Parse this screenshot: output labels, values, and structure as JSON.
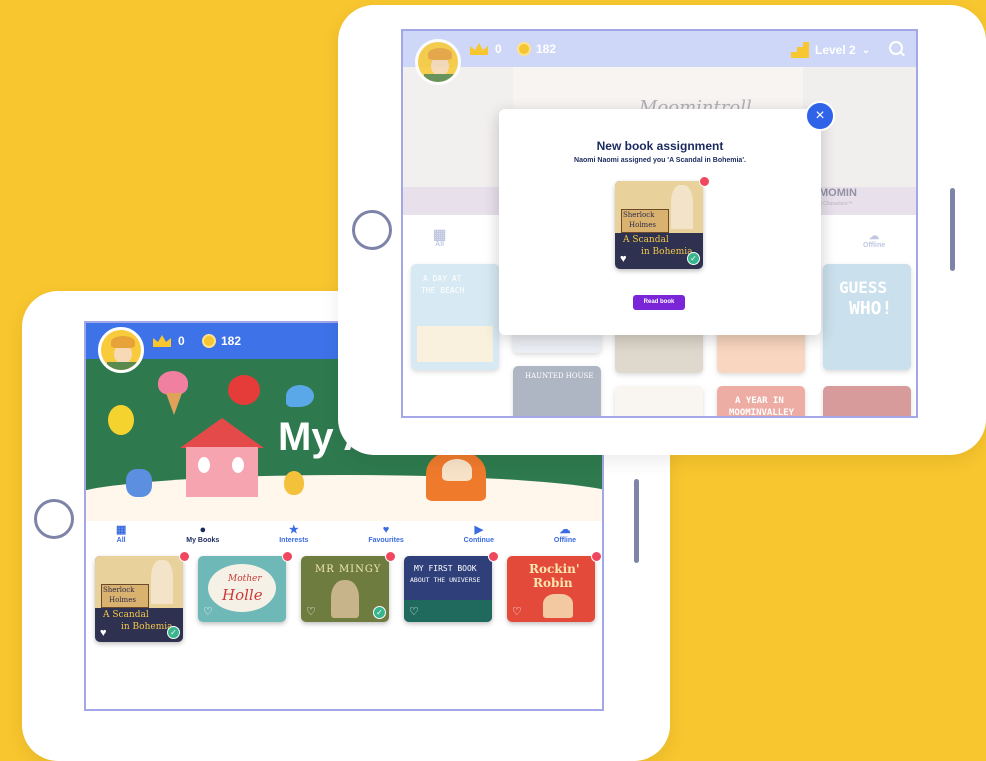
{
  "app": {
    "crowns": "0",
    "coins": "182",
    "level": "Level 2"
  },
  "front": {
    "banner_title": "My A",
    "tabs": [
      {
        "label": "All",
        "icon": "grid-icon"
      },
      {
        "label": "My Books",
        "icon": "person-icon"
      },
      {
        "label": "Interests",
        "icon": "star-icon"
      },
      {
        "label": "Favourites",
        "icon": "heart-icon"
      },
      {
        "label": "Continue",
        "icon": "play-icon"
      },
      {
        "label": "Offline",
        "icon": "cloud-download-icon"
      }
    ],
    "books": [
      {
        "line1": "Sherlock",
        "line2": "Holmes",
        "line3": "A Scandal",
        "line4": "in Bohemia"
      },
      {
        "line1": "Mother",
        "line2": "Holle"
      },
      {
        "line1": "MR MINGY"
      },
      {
        "line1": "MY FIRST BOOK",
        "line2": "ABOUT THE UNIVERSE"
      },
      {
        "line1": "Rockin'",
        "line2": "Robin"
      }
    ]
  },
  "back": {
    "banner_title": "Moomintroll",
    "banner_right": "MOMIN",
    "banner_right_sub": "n Characters™",
    "tab_all": "All",
    "tab_offline": "Offline",
    "books": [
      {
        "line1": "A DAY AT",
        "line2": "THE BEACH"
      },
      {
        "line1": "HAUNTED HOUSE"
      },
      {
        "line1": "A YEAR IN",
        "line2": "MOOMINVALLEY"
      },
      {
        "line1": "GUESS",
        "line2": "WHO!"
      }
    ],
    "modal": {
      "title": "New book assignment",
      "message": "Naomi Naomi assigned you 'A Scandal in Bohemia'.",
      "button": "Read book",
      "book": {
        "line1": "Sherlock",
        "line2": "Holmes",
        "line3": "A Scandal",
        "line4": "in Bohemia"
      }
    }
  },
  "colors": {
    "background": "#F8C62E",
    "accent_blue": "#3A6BE0",
    "topbar_front": "#3D72E8",
    "topbar_back": "#A6B6F0",
    "banner_green": "#2E7A4E",
    "read_button": "#7A25D8"
  }
}
